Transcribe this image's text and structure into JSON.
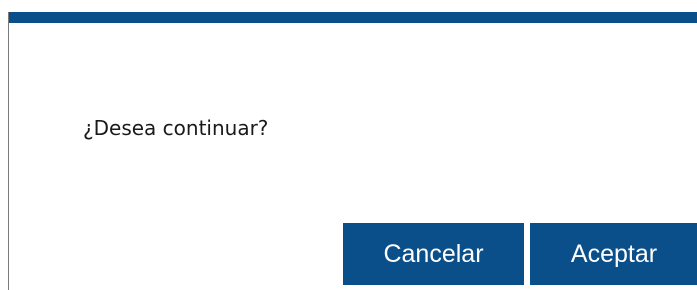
{
  "dialog": {
    "message": "¿Desea continuar?",
    "cancel_label": "Cancelar",
    "accept_label": "Aceptar"
  },
  "colors": {
    "accent": "#0b4f8a",
    "background": "#ffffff",
    "text": "#1a1a1a",
    "button_text": "#ffffff"
  }
}
